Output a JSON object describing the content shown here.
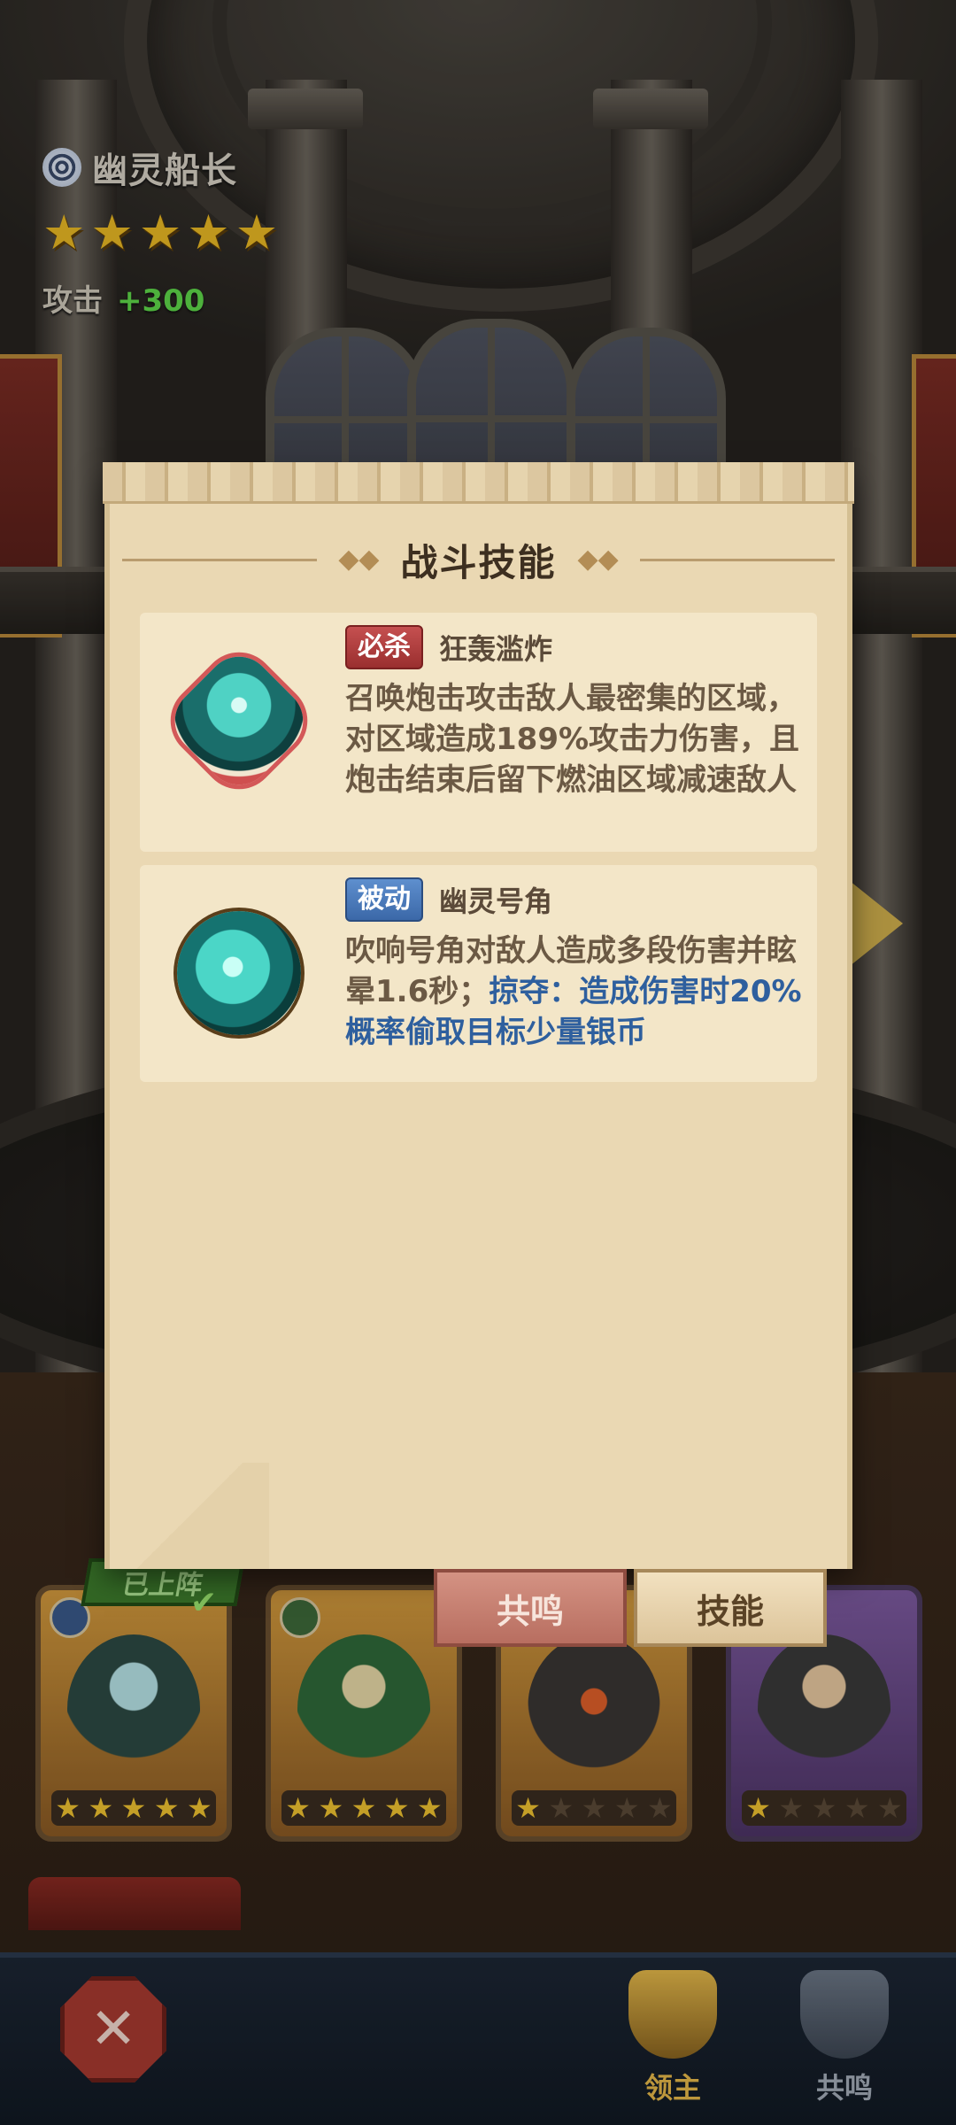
{
  "hero": {
    "name": "幽灵船长",
    "icon": "swirl-icon",
    "stars": 5,
    "attack_label": "攻击",
    "attack_value": "+300"
  },
  "dialog": {
    "title": "战斗技能",
    "skills": [
      {
        "tag": "必杀",
        "tag_color": "#b43f3f",
        "name": "狂轰滥炸",
        "icon": "cannon-barrage-icon",
        "description": "召唤炮击攻击敌人最密集的区域，对区域造成189%攻击力伤害，且炮击结束后留下燃油区域减速敌人"
      },
      {
        "tag": "被动",
        "tag_color": "#4a7bbd",
        "name": "幽灵号角",
        "icon": "ghost-horn-icon",
        "description_main": "吹响号角对敌人造成多段伤害并眩晕1.6秒；",
        "description_highlight": "掠夺：造成伤害时20%概率偷取目标少量银币"
      }
    ]
  },
  "tabs": {
    "resonance": "共鸣",
    "skill": "技能"
  },
  "roster": {
    "deployed_label": "已上阵",
    "cards": [
      {
        "stars_filled": 5,
        "stars_total": 5,
        "rarity": "gold"
      },
      {
        "stars_filled": 5,
        "stars_total": 5,
        "rarity": "gold"
      },
      {
        "stars_filled": 1,
        "stars_total": 5,
        "rarity": "gold"
      },
      {
        "stars_filled": 1,
        "stars_total": 5,
        "rarity": "purple"
      }
    ]
  },
  "bottom_nav": {
    "lord": "领主",
    "resonance": "共鸣"
  },
  "colors": {
    "panel": "#ead8b3",
    "highlight_blue": "#2e5f9e",
    "attack_green": "#5fd84a",
    "star_gold": "#e9b924"
  }
}
